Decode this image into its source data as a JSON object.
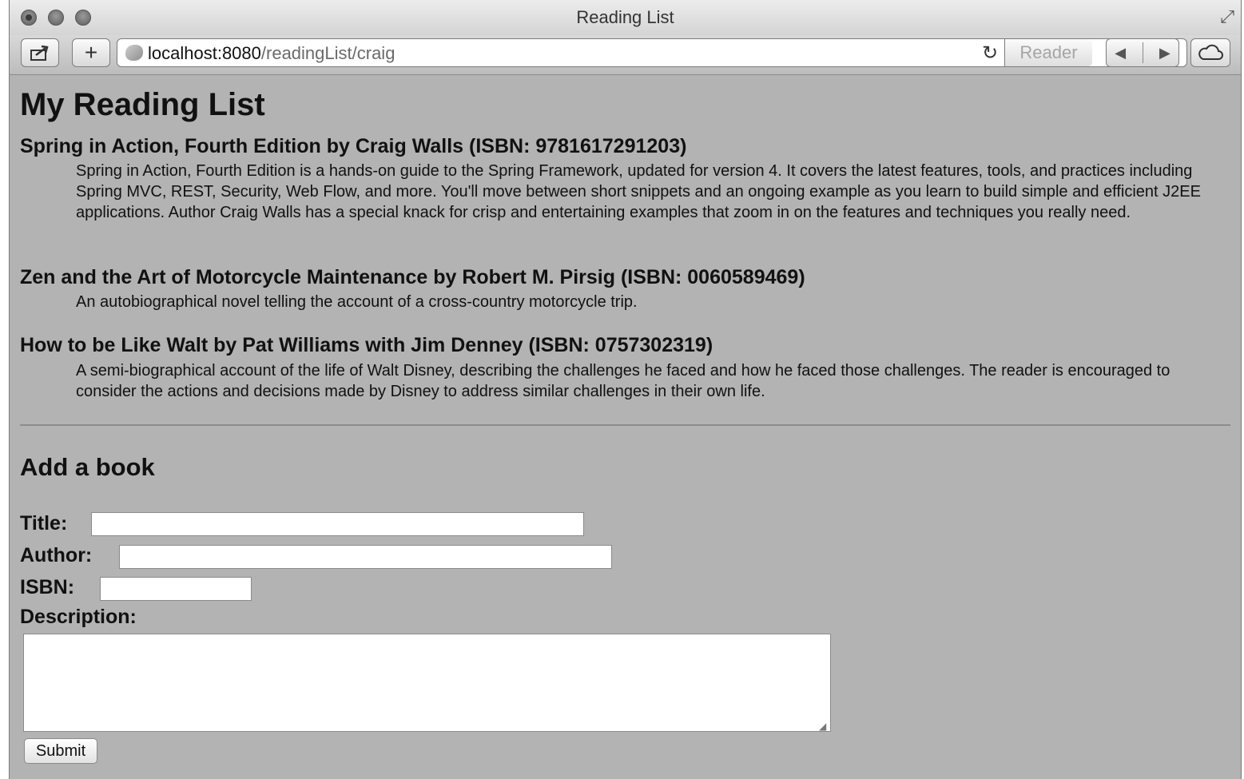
{
  "window": {
    "title": "Reading List"
  },
  "toolbar": {
    "url_host": "localhost:8080",
    "url_path": "/readingList/craig",
    "reader_label": "Reader"
  },
  "page": {
    "heading": "My Reading List",
    "books": [
      {
        "heading": "Spring in Action, Fourth Edition by Craig Walls (ISBN: 9781617291203)",
        "description": "Spring in Action, Fourth Edition is a hands-on guide to the Spring Framework, updated for version 4. It covers the latest features, tools, and practices including Spring MVC, REST, Security, Web Flow, and more. You'll move between short snippets and an ongoing example as you learn to build simple and efficient J2EE applications. Author Craig Walls has a special knack for crisp and entertaining examples that zoom in on the features and techniques you really need."
      },
      {
        "heading": "Zen and the Art of Motorcycle Maintenance by Robert M. Pirsig (ISBN: 0060589469)",
        "description": "An autobiographical novel telling the account of a cross-country motorcycle trip."
      },
      {
        "heading": "How to be Like Walt by Pat Williams with Jim Denney (ISBN: 0757302319)",
        "description": "A semi-biographical account of the life of Walt Disney, describing the challenges he faced and how he faced those challenges. The reader is encouraged to consider the actions and decisions made by Disney to address similar challenges in their own life."
      }
    ]
  },
  "form": {
    "heading": "Add a book",
    "title_label": "Title:",
    "title_value": "",
    "author_label": "Author:",
    "author_value": "",
    "isbn_label": "ISBN:",
    "isbn_value": "",
    "description_label": "Description:",
    "description_value": "",
    "submit_label": "Submit"
  },
  "icons": {
    "share": "share-icon",
    "add_tab": "plus-icon",
    "reload": "reload-icon",
    "back": "back-arrow-icon",
    "forward": "forward-arrow-icon",
    "icloud": "cloud-icon",
    "fullscreen": "fullscreen-icon"
  },
  "colors": {
    "page_background": "#b3b3b3",
    "text": "#111111"
  }
}
